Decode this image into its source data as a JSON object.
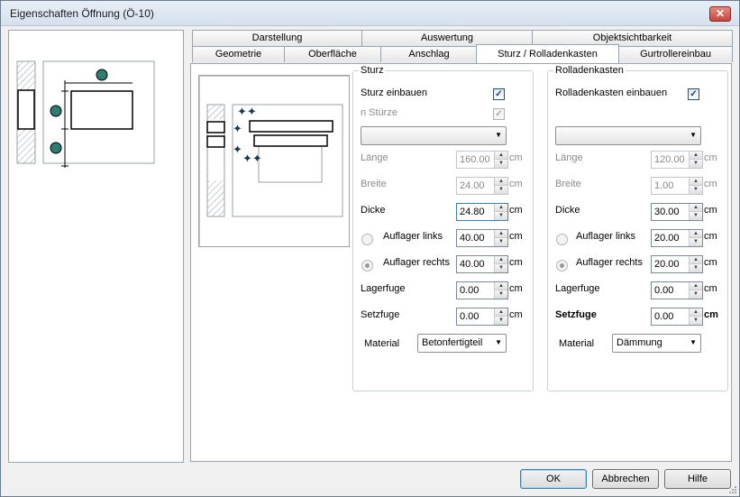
{
  "window": {
    "title": "Eigenschaften Öffnung (Ö-10)",
    "close_glyph": "✕"
  },
  "tabs_row1": [
    {
      "label": "Darstellung"
    },
    {
      "label": "Auswertung"
    },
    {
      "label": "Objektsichtbarkeit"
    }
  ],
  "tabs_row2": [
    {
      "label": "Geometrie"
    },
    {
      "label": "Oberfläche"
    },
    {
      "label": "Anschlag"
    },
    {
      "label": "Sturz / Rolladenkasten"
    },
    {
      "label": "Gurtrollereinbau"
    }
  ],
  "active_tab": "Sturz / Rolladenkasten",
  "sturz": {
    "group_title": "Sturz",
    "einbauen_label": "Sturz einbauen",
    "einbauen_checked": true,
    "n_label": "n Stürze",
    "n_checked": true,
    "combo_value": "",
    "laenge_label": "Länge",
    "laenge_value": "160.00",
    "laenge_unit": "cm",
    "breite_label": "Breite",
    "breite_value": "24.00",
    "breite_unit": "cm",
    "dicke_label": "Dicke",
    "dicke_value": "24.80",
    "dicke_unit": "cm",
    "aufl_links_label": "Auflager links",
    "aufl_links_value": "40.00",
    "aufl_links_unit": "cm",
    "aufl_rechts_label": "Auflager rechts",
    "aufl_rechts_value": "40.00",
    "aufl_rechts_unit": "cm",
    "lagerfuge_label": "Lagerfuge",
    "lagerfuge_value": "0.00",
    "lagerfuge_unit": "cm",
    "setzfuge_label": "Setzfuge",
    "setzfuge_value": "0.00",
    "setzfuge_unit": "cm",
    "material_label": "Material",
    "material_value": "Betonfertigteil"
  },
  "rolladen": {
    "group_title": "Rolladenkasten",
    "einbauen_label": "Rolladenkasten einbauen",
    "einbauen_checked": true,
    "combo_value": "",
    "laenge_label": "Länge",
    "laenge_value": "120.00",
    "laenge_unit": "cm",
    "breite_label": "Breite",
    "breite_value": "1.00",
    "breite_unit": "cm",
    "dicke_label": "Dicke",
    "dicke_value": "30.00",
    "dicke_unit": "cm",
    "aufl_links_label": "Auflager links",
    "aufl_links_value": "20.00",
    "aufl_links_unit": "cm",
    "aufl_rechts_label": "Auflager rechts",
    "aufl_rechts_value": "20.00",
    "aufl_rechts_unit": "cm",
    "lagerfuge_label": "Lagerfuge",
    "lagerfuge_value": "0.00",
    "lagerfuge_unit": "cm",
    "setzfuge_label": "Setzfuge",
    "setzfuge_value": "0.00",
    "setzfuge_unit": "cm",
    "material_label": "Material",
    "material_value": "Dämmung"
  },
  "buttons": {
    "ok": "OK",
    "cancel": "Abbrechen",
    "help": "Hilfe"
  },
  "colors": {
    "marker": "#2f7c74",
    "accent_border": "#3c7fb1"
  }
}
